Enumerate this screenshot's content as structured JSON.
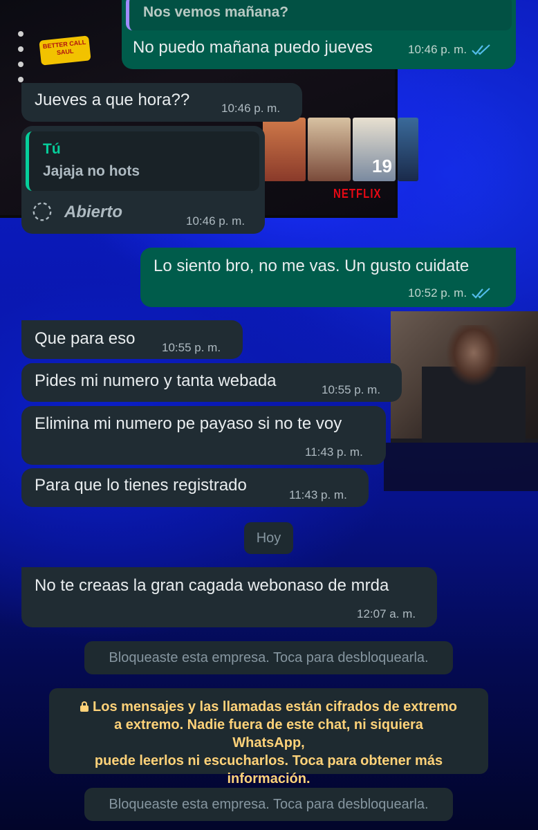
{
  "messages": [
    {
      "direction": "outgoing",
      "quoted_text": "Nos vemos mañana?",
      "text": "No puedo mañana puedo jueves",
      "time": "10:46 p. m.",
      "status": "read"
    },
    {
      "direction": "incoming",
      "text": "Jueves a que hora??",
      "time": "10:46 p. m."
    },
    {
      "direction": "incoming",
      "quoted_author": "Tú",
      "quoted_text": "Jajaja no hots",
      "view_once_label": "Abierto",
      "time": "10:46 p. m."
    },
    {
      "direction": "outgoing",
      "text": "Lo siento bro, no me vas. Un gusto cuidate",
      "time": "10:52 p. m.",
      "status": "read"
    },
    {
      "direction": "incoming",
      "text": "Que para eso",
      "time": "10:55 p. m."
    },
    {
      "direction": "incoming",
      "text": "Pides mi numero y tanta webada",
      "time": "10:55 p. m."
    },
    {
      "direction": "incoming",
      "text": "Elimina mi numero pe payaso si no te voy",
      "time": "11:43 p. m."
    },
    {
      "direction": "incoming",
      "text": "Para que lo tienes registrado",
      "time": "11:43 p. m."
    },
    {
      "direction": "incoming",
      "text": "No te creaas la gran cagada webonaso de mrda",
      "time": "12:07 a. m."
    }
  ],
  "date_separator": "Hoy",
  "system_notices": {
    "blocked_1": "Bloqueaste esta empresa. Toca para desbloquearla.",
    "encryption_lines": [
      "Los mensajes y las llamadas están cifrados de extremo",
      "a extremo. Nadie fuera de este chat, ni siquiera WhatsApp,",
      "puede leerlos ni escucharlos. Toca para obtener más",
      "información."
    ],
    "blocked_2": "Bloqueaste esta empresa. Toca para desbloquearla."
  },
  "wallpaper": {
    "tv_logo_text": "BETTER CALL SAUL",
    "tv_brand": "NETFLIX",
    "tv_badge": "19"
  },
  "colors": {
    "incoming_bubble": "#202c33",
    "outgoing_bubble": "#005c4b",
    "read_ticks": "#53bdeb",
    "quote_bar_incoming": "#06cf9c",
    "encryption_text": "#ffd279",
    "system_text": "#8696a0"
  },
  "icons": {
    "read_receipt": "double-check-icon",
    "view_once": "view-once-open-icon",
    "lock": "lock-icon"
  }
}
